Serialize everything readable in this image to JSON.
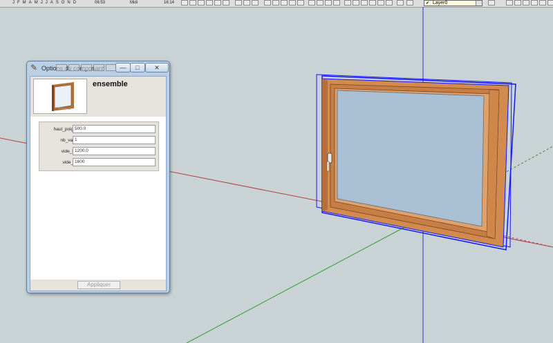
{
  "toolbar": {
    "months": [
      "J",
      "F",
      "M",
      "A",
      "M",
      "J",
      "J",
      "A",
      "S",
      "O",
      "N",
      "D"
    ],
    "time_start": "06:53",
    "midi": "Midi",
    "time_end": "16:14",
    "layer_name": "Layer0",
    "layer_check": "✔"
  },
  "dialog": {
    "title": "Options du composant",
    "min_glyph": "—",
    "max_glyph": "□",
    "close_glyph": "✕",
    "component_name": "ensemble",
    "fields": [
      {
        "label": "haut_poignee",
        "value": "500.0"
      },
      {
        "label": "nb_vantail",
        "value": "1"
      },
      {
        "label": "vide_haut",
        "value": "1200.0"
      },
      {
        "label": "vide_larg",
        "value": "1600"
      }
    ],
    "apply_label": "Appliquer"
  },
  "colors": {
    "background": "#c9d3d6",
    "wood": "#d08a4e",
    "glass": "#a9bfd4",
    "selection": "#1515ff"
  }
}
